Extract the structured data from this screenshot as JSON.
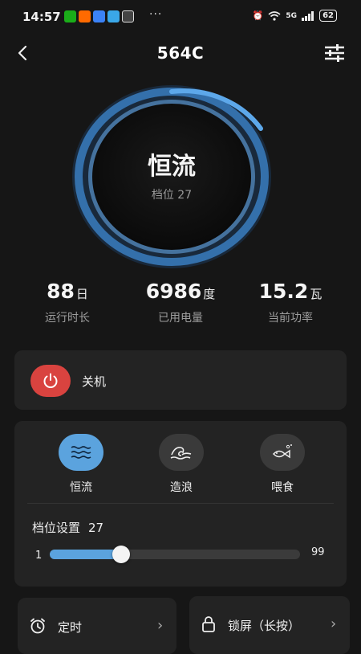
{
  "status_bar": {
    "time": "14:57",
    "dots": "···",
    "network": "5G",
    "battery": "62",
    "app_colors": [
      "#1aad19",
      "#ff6a00",
      "#3b82f6",
      "#3aa7e8",
      "#444444"
    ]
  },
  "header": {
    "title": "564C"
  },
  "dial": {
    "mode": "恒流",
    "gear_text": "档位 27",
    "ring_color": "#4a90d9"
  },
  "stats": [
    {
      "value": "88",
      "unit": "日",
      "label": "运行时长"
    },
    {
      "value": "6986",
      "unit": "度",
      "label": "已用电量"
    },
    {
      "value": "15.2",
      "unit": "瓦",
      "label": "当前功率"
    }
  ],
  "power": {
    "label": "关机",
    "color": "#d9433f"
  },
  "modes": [
    {
      "label": "恒流",
      "icon": "wave-lines-icon",
      "active": true
    },
    {
      "label": "造浪",
      "icon": "ocean-wave-icon",
      "active": false
    },
    {
      "label": "喂食",
      "icon": "fish-icon",
      "active": false
    }
  ],
  "gear_setting": {
    "title": "档位设置",
    "value": "27",
    "min": "1",
    "max": "99",
    "level": 27,
    "accent": "#5ba3de"
  },
  "bottom": {
    "timer_label": "定时",
    "lock_label": "锁屏（长按）"
  }
}
